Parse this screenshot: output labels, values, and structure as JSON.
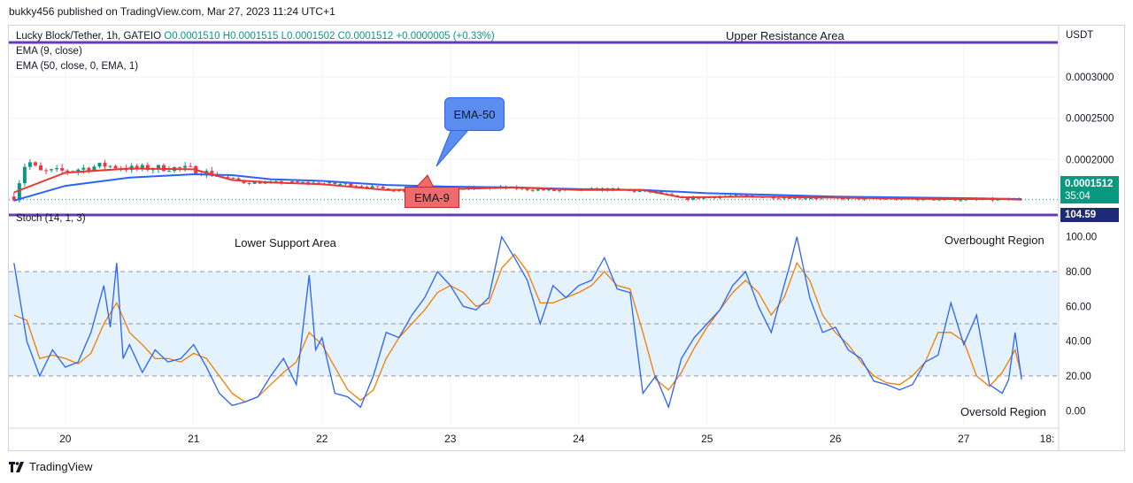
{
  "publisher": "bukky456 published on TradingView.com, Mar 27, 2023 11:24 UTC+1",
  "legend": {
    "symbol": "Lucky Block/Tether, 1h, GATEIO",
    "ohlc": "O0.0001510  H0.0001515  L0.0001502  C0.0001512  +0.0000005 (+0.33%)",
    "ema9": "EMA (9, close)",
    "ema50": "EMA (50, close, 0, EMA, 1)",
    "stoch": "Stoch (14, 1, 3)"
  },
  "annotations": {
    "upper_resistance": "Upper Resistance Area",
    "lower_support": "Lower Support Area",
    "overbought": "Overbought Region",
    "oversold": "Oversold Region",
    "ema50_callout": "EMA-50",
    "ema9_callout": "EMA-9"
  },
  "axis": {
    "unit": "USDT",
    "price_ticks": [
      "0.0003000",
      "0.0002500",
      "0.0002000"
    ],
    "last_price": "0.0001512",
    "countdown": "35:04",
    "stoch_level": "104.59",
    "stoch_ticks": [
      "100.00",
      "80.00",
      "60.00",
      "40.00",
      "20.00",
      "0.00"
    ],
    "time_ticks": [
      "20",
      "21",
      "22",
      "23",
      "24",
      "25",
      "26",
      "27",
      "18:"
    ]
  },
  "colors": {
    "up": "#089981",
    "down": "#f23645",
    "ema9": "#e53935",
    "ema50": "#2962ff",
    "stoch_k": "#2962ff",
    "stoch_d": "#f57c00",
    "level_line": "#673ab7",
    "stoch_band": "#e3f2fd"
  },
  "branding": "TradingView",
  "chart_data": [
    {
      "type": "candlestick",
      "title": "Lucky Block/Tether, 1h, GATEIO",
      "ylim": [
        0.000138,
        0.000342
      ],
      "x_ticks": [
        "20",
        "21",
        "22",
        "23",
        "24",
        "25",
        "26",
        "27"
      ],
      "upper_resistance_level": 0.000338,
      "close_path_x": [
        19.6,
        19.7,
        19.8,
        20.0,
        20.3,
        20.5,
        20.8,
        21.0,
        21.2,
        21.4,
        21.8,
        22.2,
        22.6,
        23.0,
        23.4,
        23.8,
        24.2,
        24.6,
        24.8,
        25.2,
        25.6,
        26.0,
        26.4,
        26.8,
        27.2,
        27.45
      ],
      "close_path_y": [
        0.000155,
        0.0002,
        0.000185,
        0.000186,
        0.000193,
        0.000189,
        0.00019,
        0.000188,
        0.00018,
        0.000172,
        0.000172,
        0.00017,
        0.000162,
        0.000164,
        0.000166,
        0.000162,
        0.000164,
        0.00016,
        0.000152,
        0.000156,
        0.000154,
        0.000153,
        0.000152,
        0.000152,
        0.000151,
        0.0001512
      ],
      "series": [
        {
          "name": "EMA (9, close)",
          "x": [
            19.6,
            20.0,
            20.5,
            21.0,
            21.3,
            21.6,
            22.0,
            22.5,
            23.0,
            23.5,
            24.0,
            24.5,
            24.8,
            25.3,
            25.8,
            26.3,
            26.8,
            27.3,
            27.45
          ],
          "y": [
            0.00016,
            0.000184,
            0.000189,
            0.000188,
            0.000175,
            0.000172,
            0.00017,
            0.000163,
            0.000164,
            0.000166,
            0.000163,
            0.000163,
            0.000154,
            0.000155,
            0.000154,
            0.000153,
            0.000152,
            0.000152,
            0.0001512
          ]
        },
        {
          "name": "EMA (50, close, 0, EMA, 1)",
          "x": [
            19.6,
            20.0,
            20.5,
            21.0,
            21.3,
            21.6,
            22.0,
            22.5,
            23.0,
            23.5,
            24.0,
            24.5,
            25.0,
            25.5,
            26.0,
            26.5,
            27.0,
            27.45
          ],
          "y": [
            0.00015,
            0.000168,
            0.000178,
            0.000182,
            0.000181,
            0.000176,
            0.000174,
            0.000169,
            0.000167,
            0.000166,
            0.000164,
            0.000163,
            0.000159,
            0.000157,
            0.000155,
            0.000154,
            0.000153,
            0.000152
          ]
        }
      ]
    },
    {
      "type": "line",
      "title": "Stoch (14, 1, 3)",
      "ylim": [
        -8,
        108
      ],
      "levels": [
        80,
        50,
        20
      ],
      "x_ticks": [
        "20",
        "21",
        "22",
        "23",
        "24",
        "25",
        "26",
        "27"
      ],
      "series": [
        {
          "name": "%K",
          "x": [
            19.6,
            19.7,
            19.8,
            19.9,
            20.0,
            20.1,
            20.2,
            20.3,
            20.35,
            20.4,
            20.45,
            20.5,
            20.6,
            20.7,
            20.8,
            20.9,
            21.0,
            21.1,
            21.2,
            21.3,
            21.4,
            21.5,
            21.6,
            21.7,
            21.8,
            21.9,
            21.95,
            22.0,
            22.1,
            22.2,
            22.3,
            22.4,
            22.5,
            22.6,
            22.7,
            22.8,
            22.9,
            23.0,
            23.1,
            23.2,
            23.3,
            23.4,
            23.5,
            23.6,
            23.7,
            23.8,
            23.9,
            24.0,
            24.1,
            24.2,
            24.3,
            24.4,
            24.5,
            24.6,
            24.7,
            24.8,
            24.9,
            25.0,
            25.1,
            25.2,
            25.3,
            25.4,
            25.5,
            25.6,
            25.65,
            25.7,
            25.8,
            25.9,
            26.0,
            26.1,
            26.2,
            26.3,
            26.4,
            26.5,
            26.6,
            26.7,
            26.8,
            26.9,
            27.0,
            27.1,
            27.2,
            27.3,
            27.35,
            27.4,
            27.45
          ],
          "y": [
            85,
            40,
            20,
            35,
            25,
            28,
            45,
            72,
            48,
            85,
            30,
            38,
            22,
            35,
            28,
            30,
            38,
            25,
            10,
            3,
            5,
            8,
            20,
            30,
            15,
            78,
            35,
            42,
            10,
            8,
            2,
            20,
            45,
            42,
            55,
            65,
            80,
            72,
            60,
            58,
            65,
            100,
            88,
            75,
            50,
            72,
            65,
            72,
            75,
            88,
            70,
            68,
            10,
            20,
            2,
            30,
            42,
            50,
            58,
            72,
            80,
            60,
            45,
            72,
            85,
            100,
            65,
            45,
            48,
            35,
            30,
            17,
            15,
            12,
            15,
            28,
            32,
            62,
            38,
            55,
            15,
            10,
            18,
            45,
            18
          ]
        },
        {
          "name": "%D",
          "x": [
            19.6,
            19.7,
            19.8,
            19.9,
            20.0,
            20.1,
            20.2,
            20.3,
            20.4,
            20.5,
            20.6,
            20.7,
            20.8,
            20.9,
            21.0,
            21.1,
            21.2,
            21.3,
            21.4,
            21.5,
            21.6,
            21.7,
            21.8,
            21.9,
            22.0,
            22.1,
            22.2,
            22.3,
            22.4,
            22.5,
            22.6,
            22.7,
            22.8,
            22.9,
            23.0,
            23.1,
            23.2,
            23.3,
            23.4,
            23.5,
            23.6,
            23.7,
            23.8,
            23.9,
            24.0,
            24.1,
            24.2,
            24.3,
            24.4,
            24.5,
            24.6,
            24.7,
            24.8,
            24.9,
            25.0,
            25.1,
            25.2,
            25.3,
            25.4,
            25.5,
            25.6,
            25.7,
            25.8,
            25.9,
            26.0,
            26.1,
            26.2,
            26.3,
            26.4,
            26.5,
            26.6,
            26.7,
            26.8,
            26.9,
            27.0,
            27.1,
            27.2,
            27.3,
            27.4,
            27.45
          ],
          "y": [
            55,
            52,
            30,
            32,
            30,
            27,
            33,
            50,
            62,
            45,
            38,
            30,
            30,
            28,
            33,
            30,
            20,
            10,
            5,
            8,
            15,
            22,
            28,
            45,
            38,
            25,
            12,
            6,
            12,
            30,
            42,
            50,
            58,
            68,
            72,
            68,
            60,
            62,
            82,
            90,
            80,
            62,
            62,
            65,
            68,
            72,
            80,
            72,
            70,
            45,
            18,
            12,
            22,
            36,
            48,
            58,
            68,
            75,
            68,
            55,
            65,
            85,
            75,
            55,
            45,
            38,
            28,
            20,
            16,
            15,
            20,
            28,
            45,
            45,
            40,
            20,
            14,
            22,
            35,
            20
          ]
        }
      ]
    }
  ]
}
